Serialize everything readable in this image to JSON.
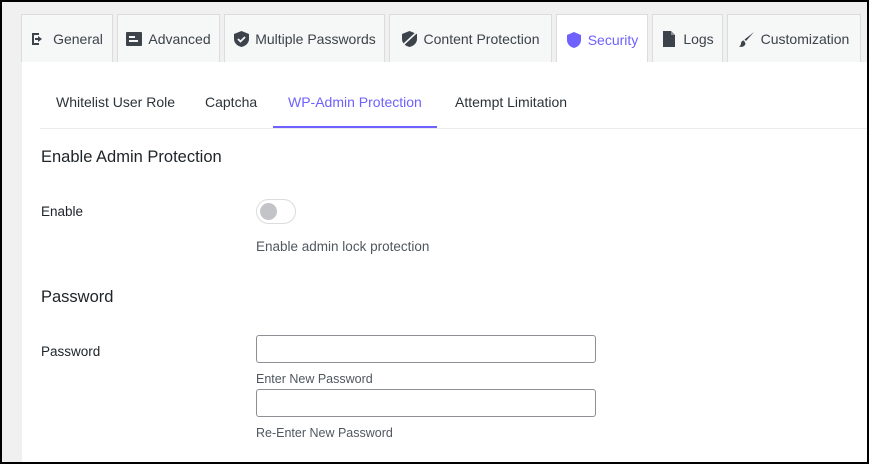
{
  "tabs": [
    {
      "label": "General",
      "icon": "login-arrow-icon"
    },
    {
      "label": "Advanced",
      "icon": "advanced-panel-icon"
    },
    {
      "label": "Multiple Passwords",
      "icon": "shield-check-icon"
    },
    {
      "label": "Content Protection",
      "icon": "shield-slash-icon"
    },
    {
      "label": "Security",
      "icon": "shield-icon",
      "active": true
    },
    {
      "label": "Logs",
      "icon": "document-icon"
    },
    {
      "label": "Customization",
      "icon": "brush-icon"
    }
  ],
  "subtabs": [
    {
      "label": "Whitelist User Role"
    },
    {
      "label": "Captcha"
    },
    {
      "label": "WP-Admin Protection",
      "active": true
    },
    {
      "label": "Attempt Limitation"
    }
  ],
  "admin_protection": {
    "title": "Enable Admin Protection",
    "enable_label": "Enable",
    "enabled": false,
    "help": "Enable admin lock protection"
  },
  "password": {
    "title": "Password",
    "label": "Password",
    "new_value": "",
    "new_hint": "Enter New Password",
    "confirm_value": "",
    "confirm_hint": "Re-Enter New Password"
  },
  "colors": {
    "accent": "#6e61ff",
    "border": "#dcdcde",
    "background": "#f0f0f1"
  }
}
